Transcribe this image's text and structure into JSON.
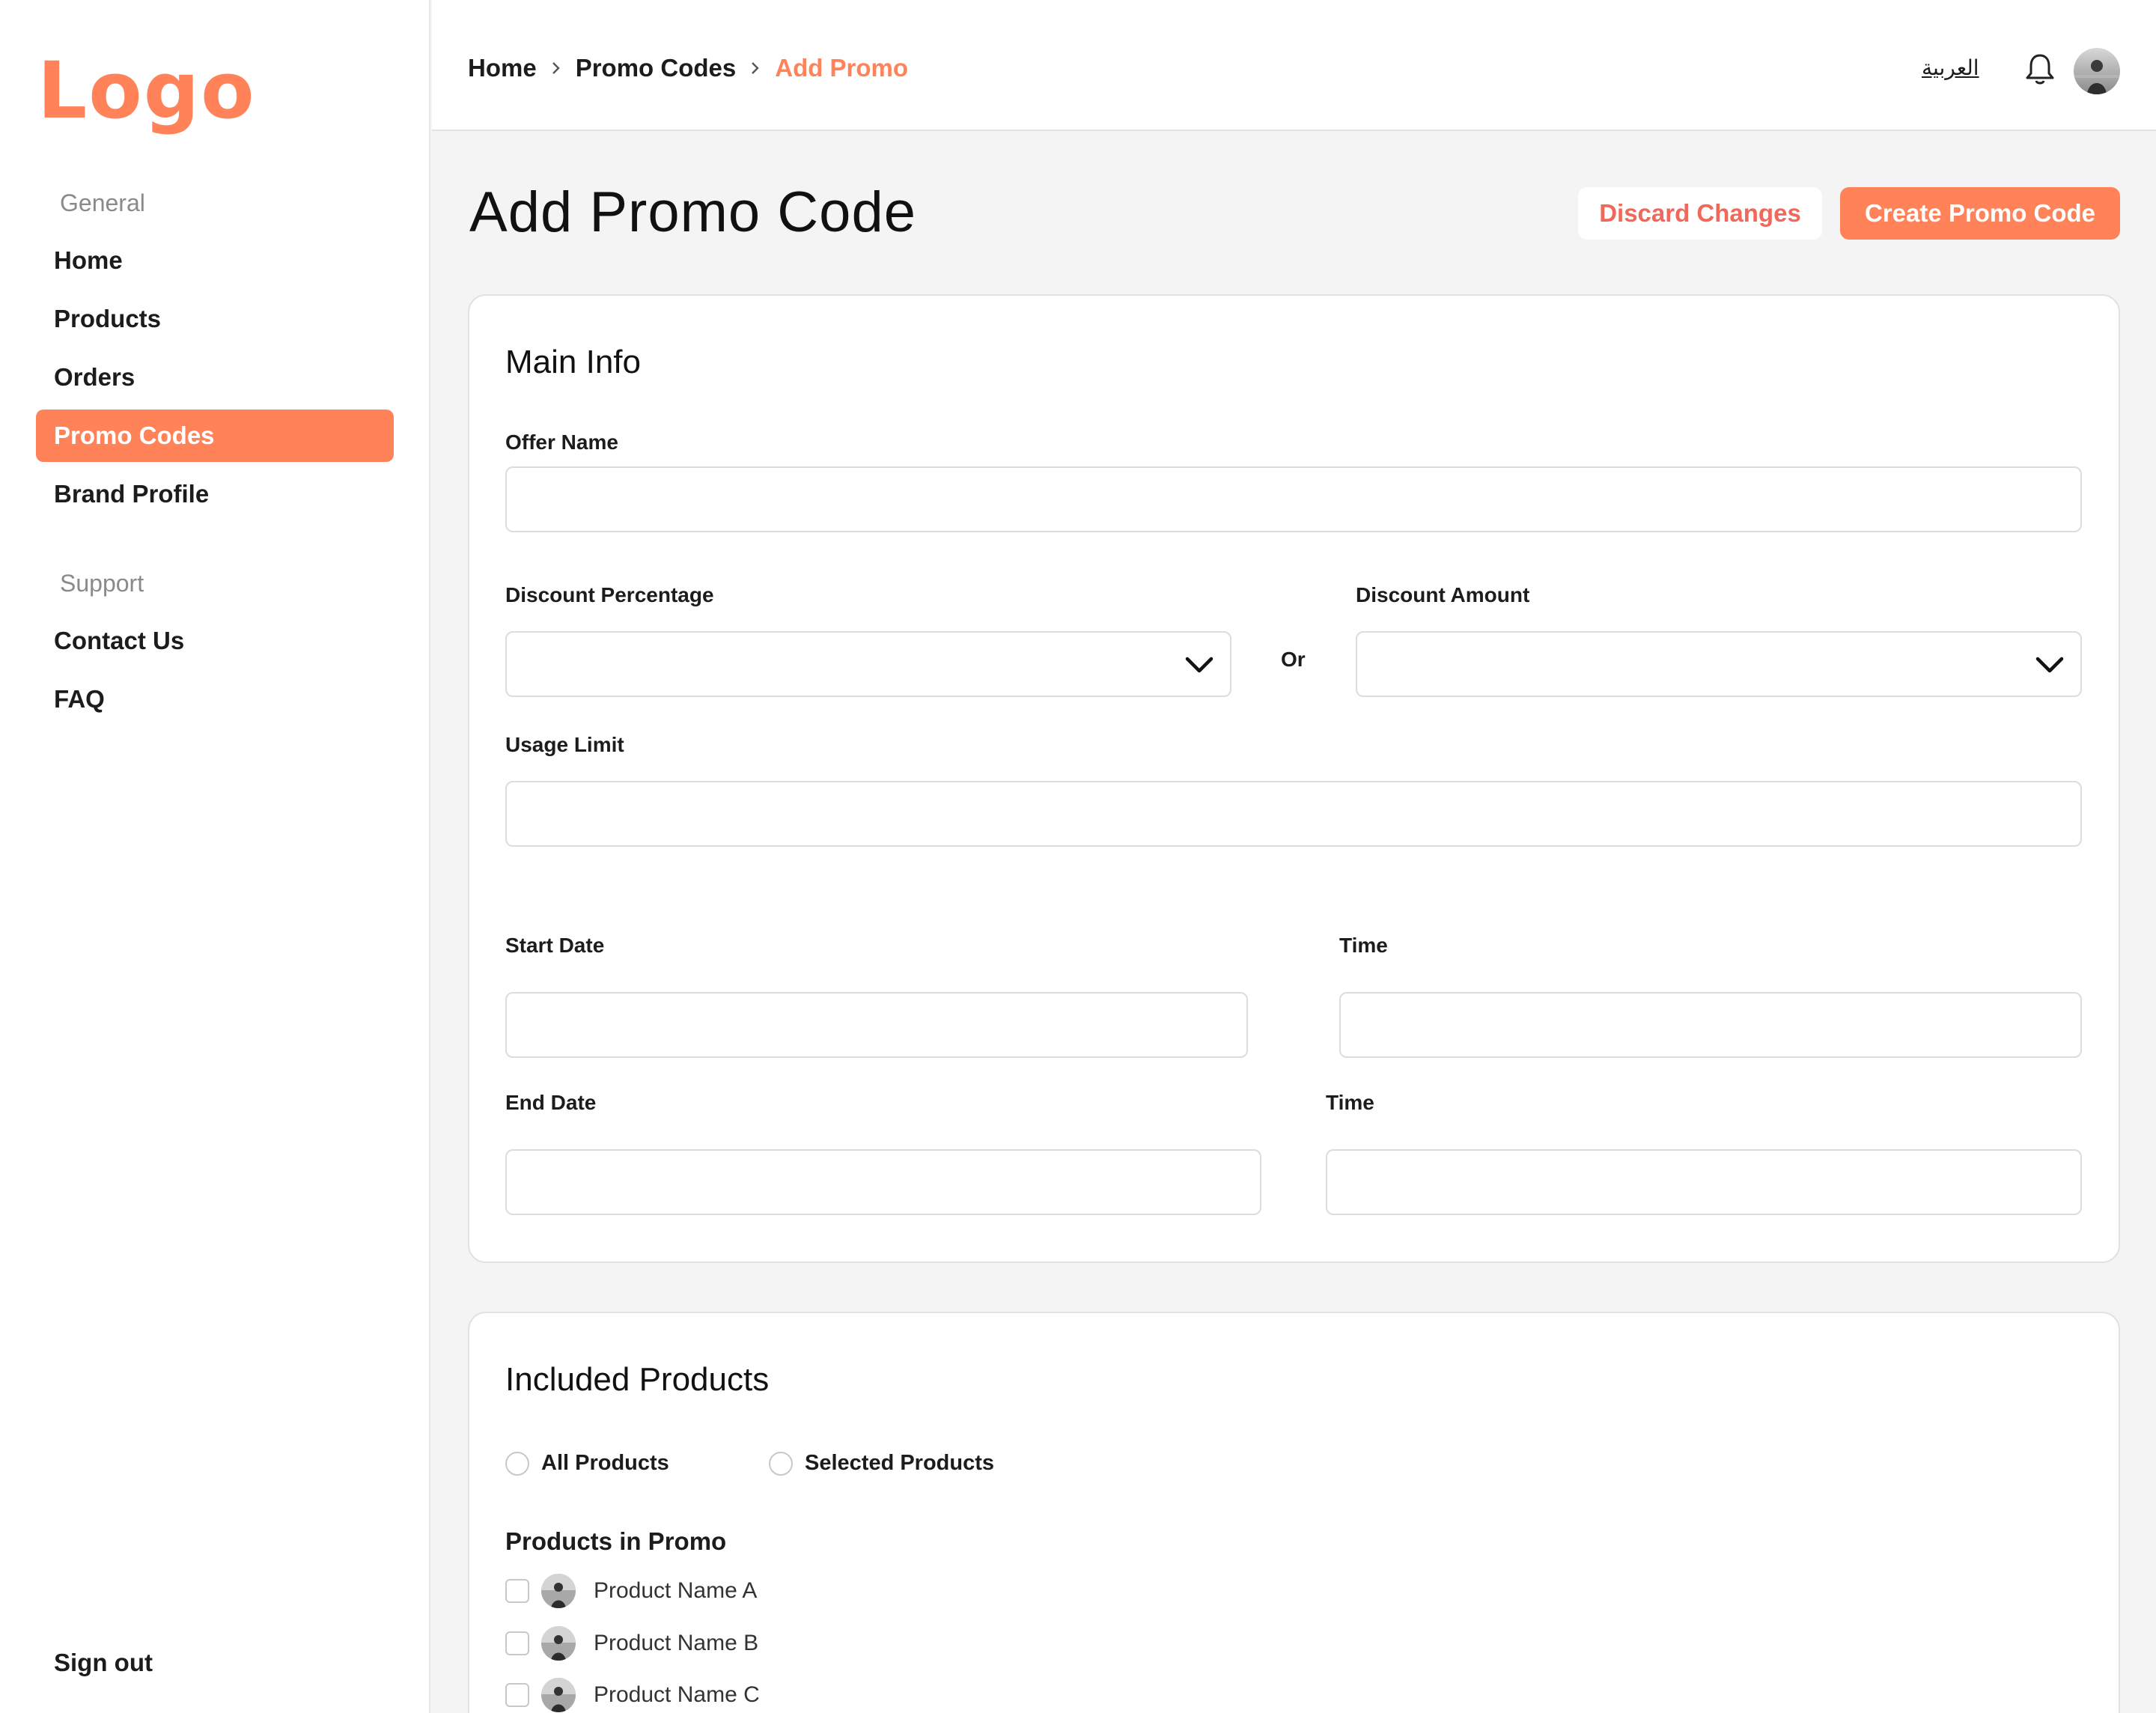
{
  "brand": {
    "logo": "Logo",
    "accent": "#ff8259"
  },
  "sidebar": {
    "general_heading": "General",
    "general_items": [
      {
        "label": "Home",
        "active": false
      },
      {
        "label": "Products",
        "active": false
      },
      {
        "label": "Orders",
        "active": false
      },
      {
        "label": "Promo Codes",
        "active": true
      },
      {
        "label": "Brand Profile",
        "active": false
      }
    ],
    "support_heading": "Support",
    "support_items": [
      {
        "label": "Contact Us"
      },
      {
        "label": "FAQ"
      }
    ],
    "sign_out": "Sign out"
  },
  "topbar": {
    "breadcrumb": [
      "Home",
      "Promo Codes",
      "Add Promo"
    ],
    "language": "العربية",
    "icons": [
      "bell-icon",
      "avatar"
    ]
  },
  "header": {
    "title": "Add Promo Code",
    "discard_label": "Discard Changes",
    "create_label": "Create Promo Code"
  },
  "main_info": {
    "title": "Main Info",
    "offer_name_label": "Offer Name",
    "offer_name_value": "",
    "discount_percentage_label": "Discount Percentage",
    "discount_percentage_value": "",
    "or_label": "Or",
    "discount_amount_label": "Discount Amount",
    "discount_amount_value": "",
    "usage_limit_label": "Usage Limit",
    "usage_limit_value": "",
    "start_date_label": "Start Date",
    "start_date_value": "",
    "start_time_label": "Time",
    "start_time_value": "",
    "end_date_label": "End Date",
    "end_date_value": "",
    "end_time_label": "Time",
    "end_time_value": ""
  },
  "included_products": {
    "title": "Included Products",
    "options": [
      "All Products",
      "Selected Products"
    ],
    "selected_option": null,
    "products_heading": "Products in Promo",
    "products": [
      {
        "name": "Product Name A",
        "checked": false
      },
      {
        "name": "Product Name B",
        "checked": false
      },
      {
        "name": "Product Name C",
        "checked": false
      }
    ]
  }
}
